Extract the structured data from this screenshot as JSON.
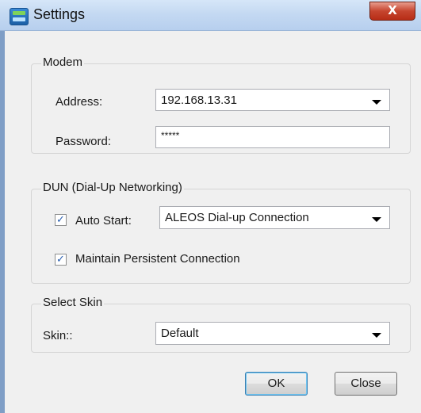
{
  "window": {
    "title": "Settings",
    "close_glyph": "X"
  },
  "modem": {
    "group_title": "Modem",
    "address_label": "Address:",
    "address_value": "192.168.13.31",
    "password_label": "Password:",
    "password_value": "*****"
  },
  "dun": {
    "group_title": "DUN (Dial-Up Networking)",
    "auto_start_label": "Auto Start:",
    "auto_start_checked": true,
    "connection_value": "ALEOS Dial-up Connection",
    "persistent_label": "Maintain Persistent Connection",
    "persistent_checked": true
  },
  "skin": {
    "group_title": "Select Skin",
    "skin_label": "Skin::",
    "skin_value": "Default"
  },
  "buttons": {
    "ok_label": "OK",
    "close_label": "Close"
  },
  "icons": {
    "app": "app-icon",
    "close": "close-icon",
    "dropdown": "chevron-down-icon",
    "check": "checkmark-icon"
  }
}
